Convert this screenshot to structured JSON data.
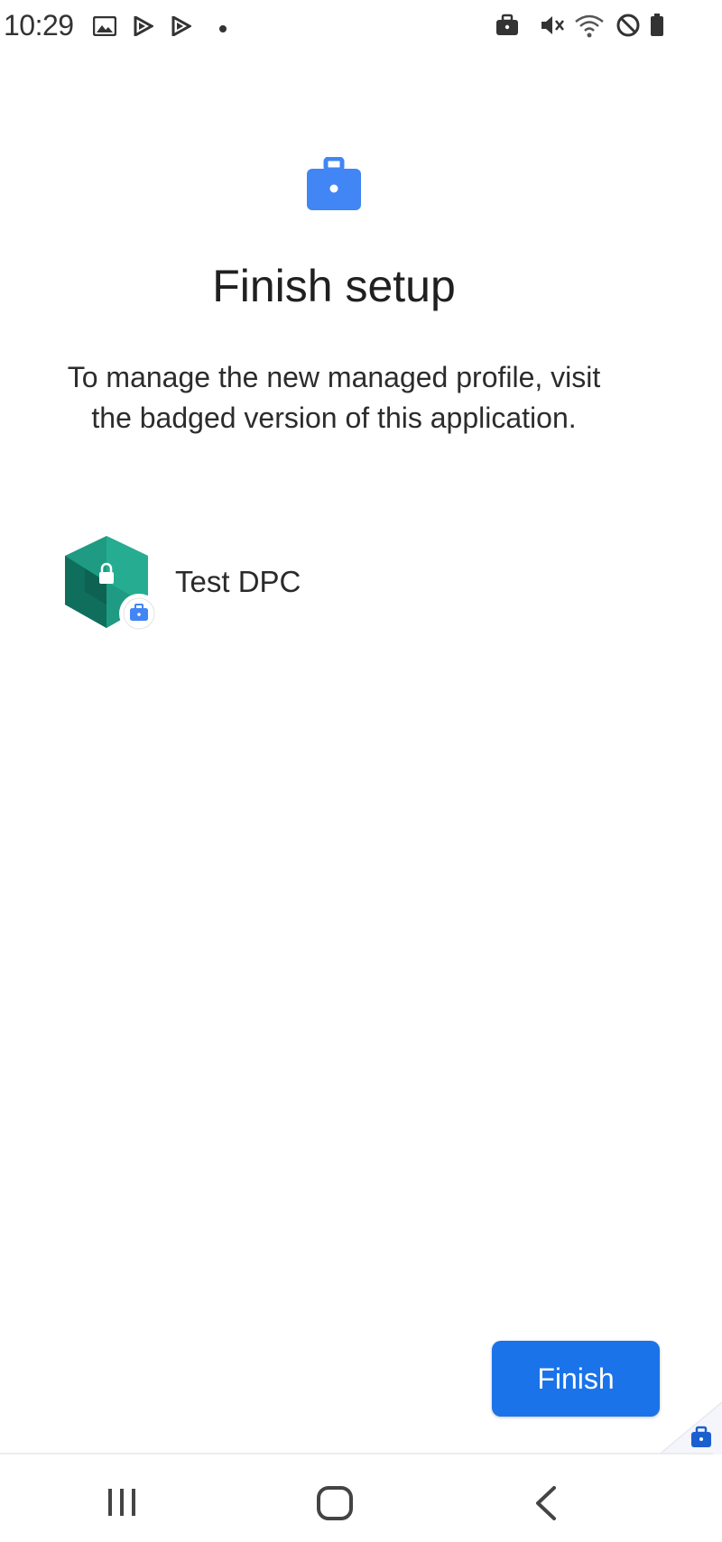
{
  "status_bar": {
    "time": "10:29",
    "icons": [
      "gallery-icon",
      "play-store-icon",
      "play-store-icon",
      "notification-dot-icon",
      "work-briefcase-icon",
      "mute-icon",
      "wifi-icon",
      "do-not-disturb-icon",
      "battery-icon"
    ]
  },
  "header": {
    "icon": "work-briefcase-icon",
    "title": "Finish setup",
    "description": "To manage the new managed profile, visit the badged version of this application."
  },
  "app": {
    "icon": "test-dpc-app-icon",
    "badge_icon": "work-badge-icon",
    "name": "Test DPC"
  },
  "actions": {
    "finish_label": "Finish"
  },
  "nav_bar": {
    "buttons": [
      "recents-icon",
      "home-icon",
      "back-icon"
    ]
  },
  "colors": {
    "accent": "#1a73e8",
    "briefcase": "#4285f4",
    "app_teal": "#1e9b82",
    "app_teal_dark": "#0f6e5c"
  }
}
